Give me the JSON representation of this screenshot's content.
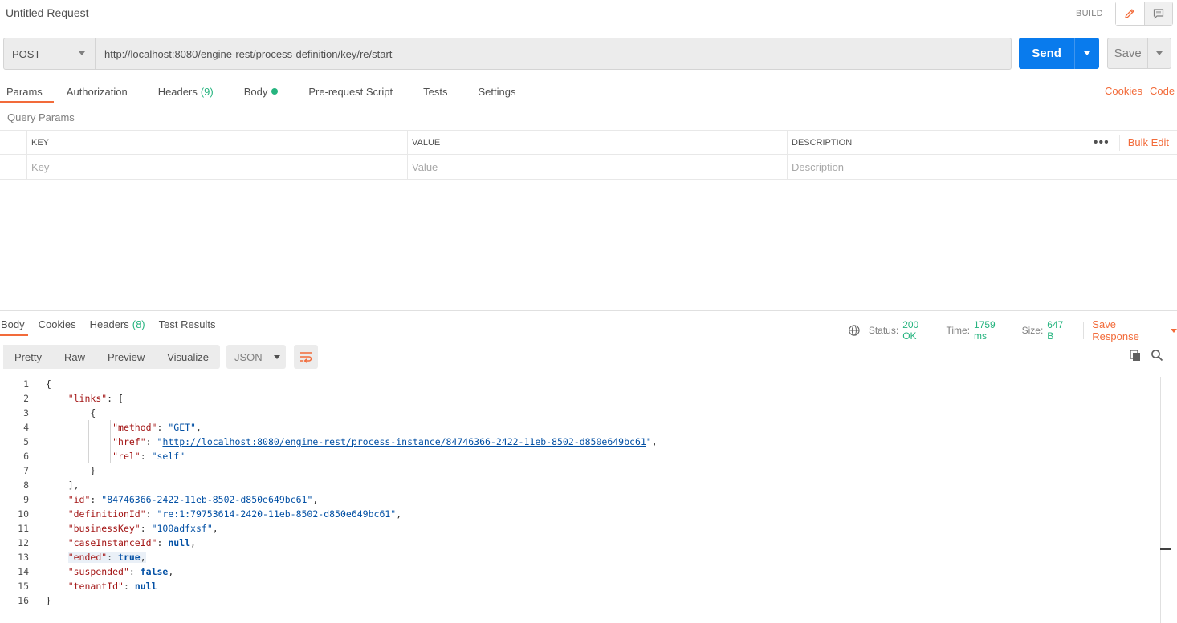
{
  "header": {
    "title": "Untitled Request",
    "build_label": "BUILD"
  },
  "request": {
    "method": "POST",
    "url": "http://localhost:8080/engine-rest/process-definition/key/re/start",
    "send_label": "Send",
    "save_label": "Save"
  },
  "request_tabs": {
    "params": "Params",
    "authorization": "Authorization",
    "headers": "Headers",
    "headers_count": "(9)",
    "body": "Body",
    "pre_request": "Pre-request Script",
    "tests": "Tests",
    "settings": "Settings",
    "cookies": "Cookies",
    "code": "Code"
  },
  "query_params": {
    "title": "Query Params",
    "columns": [
      "KEY",
      "VALUE",
      "DESCRIPTION"
    ],
    "placeholders": [
      "Key",
      "Value",
      "Description"
    ],
    "bulk_edit": "Bulk Edit",
    "more": "•••"
  },
  "response_tabs": {
    "body": "Body",
    "cookies": "Cookies",
    "headers": "Headers",
    "headers_count": "(8)",
    "test_results": "Test Results"
  },
  "response_status": {
    "status_label": "Status:",
    "status_value": "200 OK",
    "time_label": "Time:",
    "time_value": "1759 ms",
    "size_label": "Size:",
    "size_value": "647 B",
    "save_response": "Save Response"
  },
  "format": {
    "views": [
      "Pretty",
      "Raw",
      "Preview",
      "Visualize"
    ],
    "selected_view": "Pretty",
    "language": "JSON"
  },
  "colors": {
    "accent": "#f26b3a",
    "send": "#097bed",
    "success": "#26b47f"
  },
  "code_lines": [
    {
      "n": "1",
      "parts": [
        [
          "p",
          "{"
        ]
      ]
    },
    {
      "n": "2",
      "parts": [
        [
          "p",
          "    "
        ],
        [
          "k",
          "\"links\""
        ],
        [
          "p",
          ": ["
        ]
      ]
    },
    {
      "n": "3",
      "parts": [
        [
          "p",
          "        {"
        ]
      ]
    },
    {
      "n": "4",
      "parts": [
        [
          "p",
          "            "
        ],
        [
          "k",
          "\"method\""
        ],
        [
          "p",
          ": "
        ],
        [
          "s",
          "\"GET\""
        ],
        [
          "p",
          ","
        ]
      ]
    },
    {
      "n": "5",
      "parts": [
        [
          "p",
          "            "
        ],
        [
          "k",
          "\"href\""
        ],
        [
          "p",
          ": "
        ],
        [
          "s",
          "\""
        ],
        [
          "s lnk",
          "http://localhost:8080/engine-rest/process-instance/84746366-2422-11eb-8502-d850e649bc61"
        ],
        [
          "s",
          "\""
        ],
        [
          "p",
          ","
        ]
      ]
    },
    {
      "n": "6",
      "parts": [
        [
          "p",
          "            "
        ],
        [
          "k",
          "\"rel\""
        ],
        [
          "p",
          ": "
        ],
        [
          "s",
          "\"self\""
        ]
      ]
    },
    {
      "n": "7",
      "parts": [
        [
          "p",
          "        }"
        ]
      ]
    },
    {
      "n": "8",
      "parts": [
        [
          "p",
          "    ],"
        ]
      ]
    },
    {
      "n": "9",
      "parts": [
        [
          "p",
          "    "
        ],
        [
          "k",
          "\"id\""
        ],
        [
          "p",
          ": "
        ],
        [
          "s",
          "\"84746366-2422-11eb-8502-d850e649bc61\""
        ],
        [
          "p",
          ","
        ]
      ]
    },
    {
      "n": "10",
      "parts": [
        [
          "p",
          "    "
        ],
        [
          "k",
          "\"definitionId\""
        ],
        [
          "p",
          ": "
        ],
        [
          "s",
          "\"re:1:79753614-2420-11eb-8502-d850e649bc61\""
        ],
        [
          "p",
          ","
        ]
      ]
    },
    {
      "n": "11",
      "parts": [
        [
          "p",
          "    "
        ],
        [
          "k",
          "\"businessKey\""
        ],
        [
          "p",
          ": "
        ],
        [
          "s",
          "\"100adfxsf\""
        ],
        [
          "p",
          ","
        ]
      ]
    },
    {
      "n": "12",
      "parts": [
        [
          "p",
          "    "
        ],
        [
          "k",
          "\"caseInstanceId\""
        ],
        [
          "p",
          ": "
        ],
        [
          "kw",
          "null"
        ],
        [
          "p",
          ","
        ]
      ]
    },
    {
      "n": "13",
      "parts": [
        [
          "p",
          "    "
        ],
        [
          "k hl",
          "\"ended\""
        ],
        [
          "p hl",
          ": "
        ],
        [
          "kw hl",
          "true"
        ],
        [
          "p hl",
          ","
        ]
      ]
    },
    {
      "n": "14",
      "parts": [
        [
          "p",
          "    "
        ],
        [
          "k",
          "\"suspended\""
        ],
        [
          "p",
          ": "
        ],
        [
          "kw",
          "false"
        ],
        [
          "p",
          ","
        ]
      ]
    },
    {
      "n": "15",
      "parts": [
        [
          "p",
          "    "
        ],
        [
          "k",
          "\"tenantId\""
        ],
        [
          "p",
          ": "
        ],
        [
          "kw",
          "null"
        ]
      ]
    },
    {
      "n": "16",
      "parts": [
        [
          "p",
          "}"
        ]
      ]
    }
  ]
}
